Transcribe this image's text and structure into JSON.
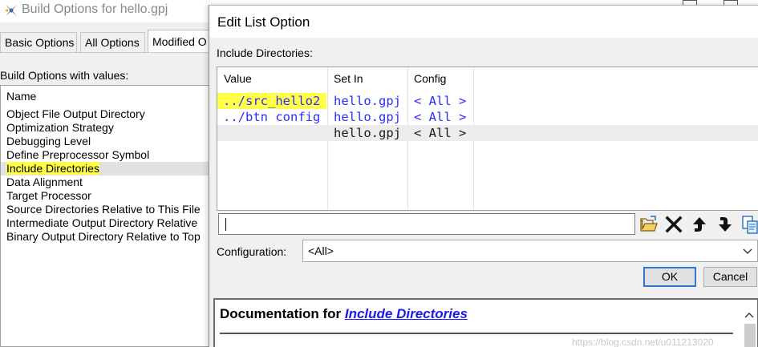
{
  "background_window": {
    "title": "Build Options for hello.gpj",
    "tabs": [
      {
        "label": "Basic Options"
      },
      {
        "label": "All Options"
      },
      {
        "label": "Modified O"
      }
    ],
    "values_label": "Build Options with values:",
    "list_header": "Name",
    "items": [
      {
        "label": "Object File Output Directory"
      },
      {
        "label": "Optimization Strategy"
      },
      {
        "label": "Debugging Level"
      },
      {
        "label": "Define Preprocessor Symbol"
      },
      {
        "label": "Include Directories"
      },
      {
        "label": "Data Alignment"
      },
      {
        "label": "Target Processor"
      },
      {
        "label": "Source Directories Relative to This File"
      },
      {
        "label": "Intermediate Output Directory Relative"
      },
      {
        "label": "Binary Output Directory Relative to Top"
      }
    ],
    "selected_index": 4
  },
  "dialog": {
    "title": "Edit List Option",
    "include_label": "Include Directories:",
    "columns": [
      "Value",
      "Set In",
      "Config"
    ],
    "rows": [
      {
        "value": "../src_hello2",
        "set_in": "hello.gpj",
        "config": "< All >"
      },
      {
        "value": "../btn config",
        "set_in": "hello.gpj",
        "config": "< All >"
      },
      {
        "value": "",
        "set_in": "hello.gpj",
        "config": "< All >"
      }
    ],
    "input_value": "",
    "toolbar": {
      "open_icon": "folder-open-icon",
      "delete_icon": "delete-x-icon",
      "up_icon": "move-up-icon",
      "down_icon": "move-down-icon",
      "copy_icon": "copy-document-icon"
    },
    "config_label": "Configuration:",
    "config_value": "<All>",
    "ok_label": "OK",
    "cancel_label": "Cancel",
    "doc_heading_prefix": "Documentation for ",
    "doc_link": "Include Directories"
  },
  "watermark": "https://blog.csdn.net/u011213020",
  "colors": {
    "highlight": "#ffff4a",
    "link_blue": "#2b2bff",
    "focus_border": "#2d7ad6"
  }
}
